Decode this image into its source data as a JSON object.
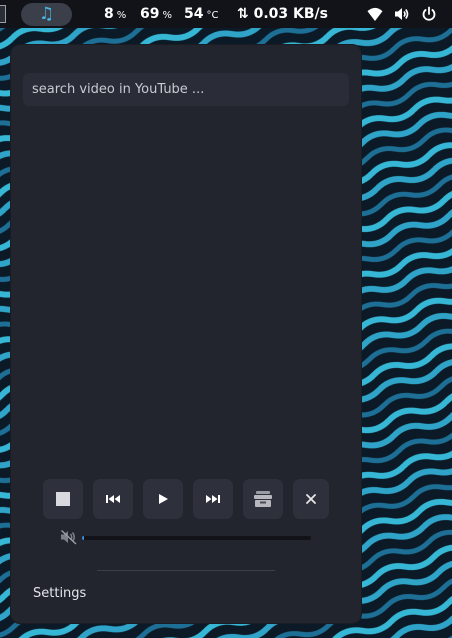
{
  "topbar": {
    "music_icon": "music-note-icon",
    "cpu": {
      "value": "8",
      "unit": "%"
    },
    "memory": {
      "value": "69",
      "unit": "%"
    },
    "temperature": {
      "value": "54",
      "unit": "°C"
    },
    "network": {
      "arrows": "⇅",
      "value": "0.03 KB/s"
    },
    "tray": [
      "wifi-icon",
      "volume-icon",
      "power-icon"
    ]
  },
  "player": {
    "search_placeholder": "search video in YouTube ...",
    "search_value": "",
    "controls": [
      "stop-icon",
      "previous-icon",
      "play-icon",
      "next-icon",
      "archive-icon",
      "close-icon"
    ],
    "muted": true,
    "progress_percent": 1,
    "settings_label": "Settings"
  },
  "colors": {
    "accent": "#3b8fe0",
    "music_icon": "#46b8e8",
    "panel": "#22242e",
    "topbar": "#111318"
  }
}
